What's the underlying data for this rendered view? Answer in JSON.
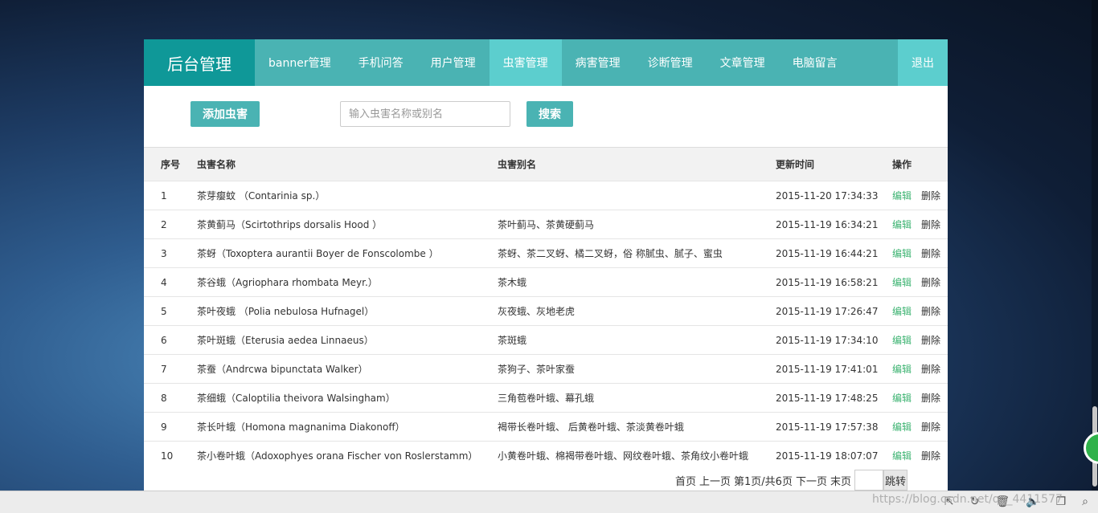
{
  "nav": {
    "brand": "后台管理",
    "items": [
      "banner管理",
      "手机问答",
      "用户管理",
      "虫害管理",
      "病害管理",
      "诊断管理",
      "文章管理",
      "电脑留言"
    ],
    "active_index": 3,
    "logout": "退出"
  },
  "toolbar": {
    "add_label": "添加虫害",
    "search_placeholder": "输入虫害名称或别名",
    "search_label": "搜索"
  },
  "table": {
    "headers": [
      "序号",
      "虫害名称",
      "虫害别名",
      "更新时间",
      "操作"
    ],
    "edit_label": "编辑",
    "delete_label": "删除",
    "rows": [
      {
        "idx": "1",
        "name": "茶芽瘿蚊 （Contarinia sp.）",
        "alias": "",
        "time": "2015-11-20 17:34:33"
      },
      {
        "idx": "2",
        "name": "茶黄蓟马（Scirtothrips dorsalis Hood ）",
        "alias": "茶叶蓟马、茶黄硬蓟马",
        "time": "2015-11-19 16:34:21"
      },
      {
        "idx": "3",
        "name": "茶蚜（Toxoptera aurantii Boyer de Fonscolombe ）",
        "alias": "茶蚜、茶二叉蚜、橘二叉蚜，俗 称腻虫、腻子、蜜虫",
        "time": "2015-11-19 16:44:21"
      },
      {
        "idx": "4",
        "name": "茶谷蛾（Agriophara rhombata Meyr.）",
        "alias": "茶木蛾",
        "time": "2015-11-19 16:58:21"
      },
      {
        "idx": "5",
        "name": "茶叶夜蛾 （Polia nebulosa Hufnagel）",
        "alias": "灰夜蛾、灰地老虎",
        "time": "2015-11-19 17:26:47"
      },
      {
        "idx": "6",
        "name": "茶叶斑蛾（Eterusia aedea Linnaeus）",
        "alias": "茶斑蛾",
        "time": "2015-11-19 17:34:10"
      },
      {
        "idx": "7",
        "name": "茶蚕（Andrcwa bipunctata Walker）",
        "alias": "茶狗子、茶叶家蚕",
        "time": "2015-11-19 17:41:01"
      },
      {
        "idx": "8",
        "name": "茶细蛾（Caloptilia theivora Walsingham）",
        "alias": "三角苞卷叶蛾、幕孔蛾",
        "time": "2015-11-19 17:48:25"
      },
      {
        "idx": "9",
        "name": "茶长叶蛾（Homona magnanima Diakonoff）",
        "alias": "褐带长卷叶蛾、 后黄卷叶蛾、茶淡黄卷叶蛾",
        "time": "2015-11-19 17:57:38"
      },
      {
        "idx": "10",
        "name": "茶小卷叶蛾（Adoxophyes orana Fischer von Roslerstamm）",
        "alias": "小黄卷叶蛾、棉褐带卷叶蛾、网纹卷叶蛾、茶角纹小卷叶蛾",
        "time": "2015-11-19 18:07:07"
      }
    ]
  },
  "pager": {
    "first": "首页",
    "prev": "上一页",
    "info": "第1页/共6页",
    "next": "下一页",
    "last": "末页",
    "jump": "跳转"
  },
  "watermark": "https://blog.csdn.net/qq_4411577"
}
